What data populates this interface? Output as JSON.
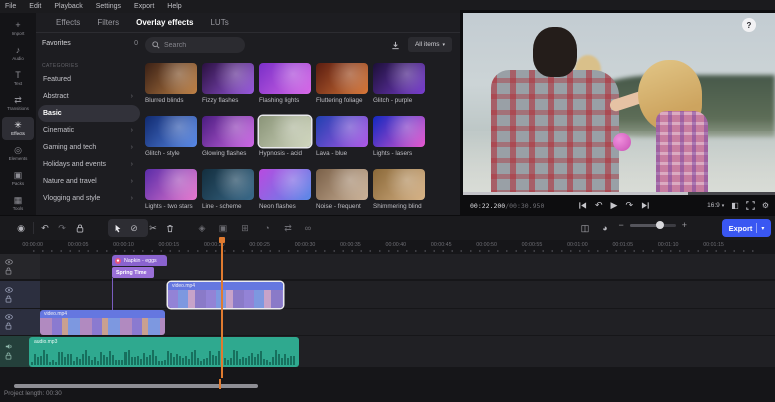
{
  "menu_bar": [
    "File",
    "Edit",
    "Playback",
    "Settings",
    "Export",
    "Help"
  ],
  "sidebar": [
    {
      "icon": "+",
      "label": "Import"
    },
    {
      "icon": "♪",
      "label": "Audio"
    },
    {
      "icon": "T",
      "label": "Text"
    },
    {
      "icon": "⇄",
      "label": "Transitions"
    },
    {
      "icon": "✳",
      "label": "Effects",
      "active": true
    },
    {
      "icon": "◎",
      "label": "Elements"
    },
    {
      "icon": "▣",
      "label": "Packs"
    },
    {
      "icon": "▦",
      "label": "Tools"
    }
  ],
  "panel": {
    "tabs": [
      {
        "label": "Effects"
      },
      {
        "label": "Filters"
      },
      {
        "label": "Overlay effects",
        "active": true
      },
      {
        "label": "LUTs"
      }
    ],
    "favorites_label": "Favorites",
    "favorites_count": "0",
    "categories_heading": "CATEGORIES",
    "categories": [
      {
        "label": "Featured",
        "chevron": ""
      },
      {
        "label": "Abstract",
        "chevron": "›"
      },
      {
        "label": "Basic",
        "chevron": "",
        "selected": true
      },
      {
        "label": "Cinematic",
        "chevron": "›"
      },
      {
        "label": "Gaming and tech",
        "chevron": "›"
      },
      {
        "label": "Holidays and events",
        "chevron": "›"
      },
      {
        "label": "Nature and travel",
        "chevron": "›"
      },
      {
        "label": "Vlogging and style",
        "chevron": "›"
      }
    ],
    "search_placeholder": "Search",
    "filter_label": "All items",
    "effects": [
      {
        "name": "Blurred blinds",
        "c1": "#3a2015",
        "c2": "#c08348"
      },
      {
        "name": "Fizzy flashes",
        "c1": "#2a1040",
        "c2": "#9a5ae0"
      },
      {
        "name": "Flashing lights",
        "c1": "#7a2fc8",
        "c2": "#d86ae8"
      },
      {
        "name": "Fluttering foliage",
        "c1": "#5a1c10",
        "c2": "#d8783a"
      },
      {
        "name": "Glitch - purple",
        "c1": "#1c0f38",
        "c2": "#7a3fd0"
      },
      {
        "name": "Glitch - style",
        "c1": "#102a70",
        "c2": "#5a8ae8"
      },
      {
        "name": "Glowing flashes",
        "c1": "#4a1c80",
        "c2": "#d06ae8"
      },
      {
        "name": "Hypnosis - acid",
        "c1": "#8a9478",
        "c2": "#d2d8c0",
        "bordered": true
      },
      {
        "name": "Lava - blue",
        "c1": "#2040b0",
        "c2": "#b05ae8"
      },
      {
        "name": "Lights - lasers",
        "c1": "#1228c0",
        "c2": "#e85ad0"
      },
      {
        "name": "Lights - two stars",
        "c1": "#5a2ca8",
        "c2": "#e87ad0"
      },
      {
        "name": "Line - scheme",
        "c1": "#132e3e",
        "c2": "#3a6a8a"
      },
      {
        "name": "Neon flashes",
        "c1": "#b84ae0",
        "c2": "#5a8ae8"
      },
      {
        "name": "Noise - frequent",
        "c1": "#7a6048",
        "c2": "#cdb49a"
      },
      {
        "name": "Shimmering blind",
        "c1": "#8a6838",
        "c2": "#d8b488"
      }
    ]
  },
  "player": {
    "current": "00:22.200",
    "total": "/00:30.950",
    "ratio": "16:9",
    "progress_pct": 72
  },
  "timeline": {
    "ruler": [
      "00:00:00",
      "00:00:05",
      "00:00:10",
      "00:00:15",
      "00:00:20",
      "00:00:25",
      "00:00:30",
      "00:00:35",
      "00:00:40",
      "00:00:45",
      "00:00:50",
      "00:00:55",
      "00:01:00",
      "00:01:05",
      "00:01:10",
      "00:01:15"
    ],
    "clips": {
      "effect_title": "Napkin - eggs",
      "effect_sub": "Spring Time",
      "video_top": "video.mp4",
      "video_main": "video.mp4",
      "audio": "audio.mp3"
    }
  },
  "export_label": "Export",
  "status": {
    "project_length": "Project length: 00:30"
  },
  "colors": {
    "accent_blue": "#3a57f2",
    "playhead_orange": "#e07b30",
    "audio_teal": "#2fa98f",
    "effect_purple": "#8a63cf",
    "clip_header_blue": "#6577e0"
  }
}
